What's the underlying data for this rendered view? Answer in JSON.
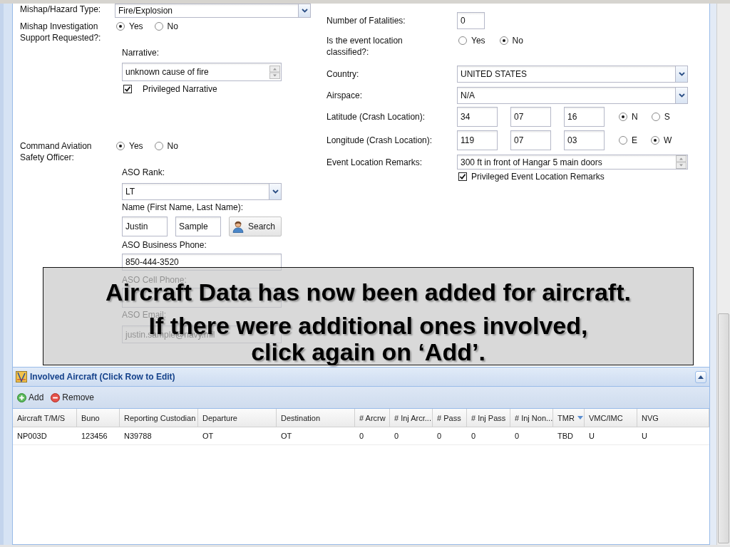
{
  "mishap_type": {
    "label": "Mishap/Hazard Type:",
    "value": "Fire/Explosion"
  },
  "investigation_support": {
    "label": "Mishap Investigation Support Requested?:",
    "options": [
      {
        "label": "Yes",
        "selected": true
      },
      {
        "label": "No",
        "selected": false
      }
    ]
  },
  "narrative": {
    "label": "Narrative:",
    "value": "unknown cause of fire",
    "privileged": {
      "label": "Privileged Narrative",
      "checked": true
    }
  },
  "aviation_safety_officer": {
    "label": "Command Aviation Safety Officer:",
    "options": [
      {
        "label": "Yes",
        "selected": true
      },
      {
        "label": "No",
        "selected": false
      }
    ],
    "rank": {
      "label": "ASO Rank:",
      "value": "LT"
    },
    "name": {
      "label": "Name (First Name, Last Name):",
      "first_name": "Justin",
      "last_name": "Sample",
      "search_button": "Search"
    },
    "business_phone": {
      "label": "ASO Business Phone:",
      "value": "850-444-3520"
    },
    "cell_phone": {
      "label": "ASO Cell Phone:"
    },
    "email": {
      "label": "ASO Email:",
      "value": "justin.sample@navy.mil"
    }
  },
  "fatalities": {
    "label": "Number of Fatalities:",
    "value": "0"
  },
  "location_classified": {
    "label": "Is the event location classified?:",
    "options": [
      {
        "label": "Yes",
        "selected": false
      },
      {
        "label": "No",
        "selected": true
      }
    ]
  },
  "country": {
    "label": "Country:",
    "value": "UNITED STATES"
  },
  "airspace": {
    "label": "Airspace:",
    "value": "N/A"
  },
  "latitude": {
    "label": "Latitude (Crash Location):",
    "values": [
      "34",
      "07",
      "16"
    ],
    "options": [
      {
        "label": "N",
        "selected": true
      },
      {
        "label": "S",
        "selected": false
      }
    ]
  },
  "longitude": {
    "label": "Longitude (Crash Location):",
    "values": [
      "119",
      "07",
      "03"
    ],
    "options": [
      {
        "label": "E",
        "selected": false
      },
      {
        "label": "W",
        "selected": true
      }
    ]
  },
  "location_remarks": {
    "label": "Event Location Remarks:",
    "value": "300 ft in front of Hangar 5 main doors",
    "privileged": {
      "label": "Privileged Event Location Remarks",
      "checked": true
    }
  },
  "callout": {
    "lines": [
      "Aircraft Data has now been added for aircraft.",
      "If there were additional ones involved,",
      "click again on ‘Add’."
    ]
  },
  "aircraft_panel": {
    "title": "Involved Aircraft (Click Row to Edit)",
    "toolbar": [
      {
        "kind": "add",
        "label": "Add"
      },
      {
        "kind": "remove",
        "label": "Remove"
      }
    ],
    "columns": [
      {
        "label": "Aircraft T/M/S",
        "sorted": false
      },
      {
        "label": "Buno",
        "sorted": false
      },
      {
        "label": "Reporting Custodian",
        "sorted": false
      },
      {
        "label": "Departure",
        "sorted": false
      },
      {
        "label": "Destination",
        "sorted": false
      },
      {
        "label": "# Arcrw",
        "sorted": false
      },
      {
        "label": "# Inj Arcr...",
        "sorted": false
      },
      {
        "label": "# Pass",
        "sorted": false
      },
      {
        "label": "# Inj Pass",
        "sorted": false
      },
      {
        "label": "# Inj Non...",
        "sorted": false
      },
      {
        "label": "TMR",
        "sorted": true
      },
      {
        "label": "VMC/IMC",
        "sorted": false
      },
      {
        "label": "NVG",
        "sorted": false
      }
    ],
    "rows": [
      [
        "NP003D",
        "123456",
        "N39788",
        "OT",
        "OT",
        "0",
        "0",
        "0",
        "0",
        "0",
        "TBD",
        "U",
        "U"
      ]
    ]
  }
}
